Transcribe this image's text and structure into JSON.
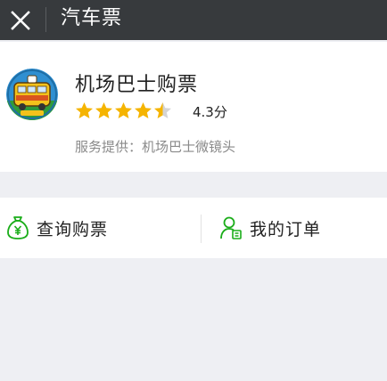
{
  "header": {
    "close_icon": "close-icon",
    "title": "汽车票"
  },
  "app": {
    "logo_icon": "bus-logo",
    "name": "机场巴士购票",
    "rating_stars": 4.5,
    "rating_max": 5,
    "rating_text": "4.3分",
    "provider": "服务提供：机场巴士微镜头",
    "star_color": "#f5b400",
    "star_empty_color": "#d4d4d4"
  },
  "actions": [
    {
      "label": "查询购票",
      "icon": "money-bag-icon"
    },
    {
      "label": "我的订单",
      "icon": "user-order-icon"
    }
  ],
  "colors": {
    "accent_green": "#1aad19",
    "topbar_bg": "#373a3d",
    "page_bg": "#eeeff3"
  }
}
